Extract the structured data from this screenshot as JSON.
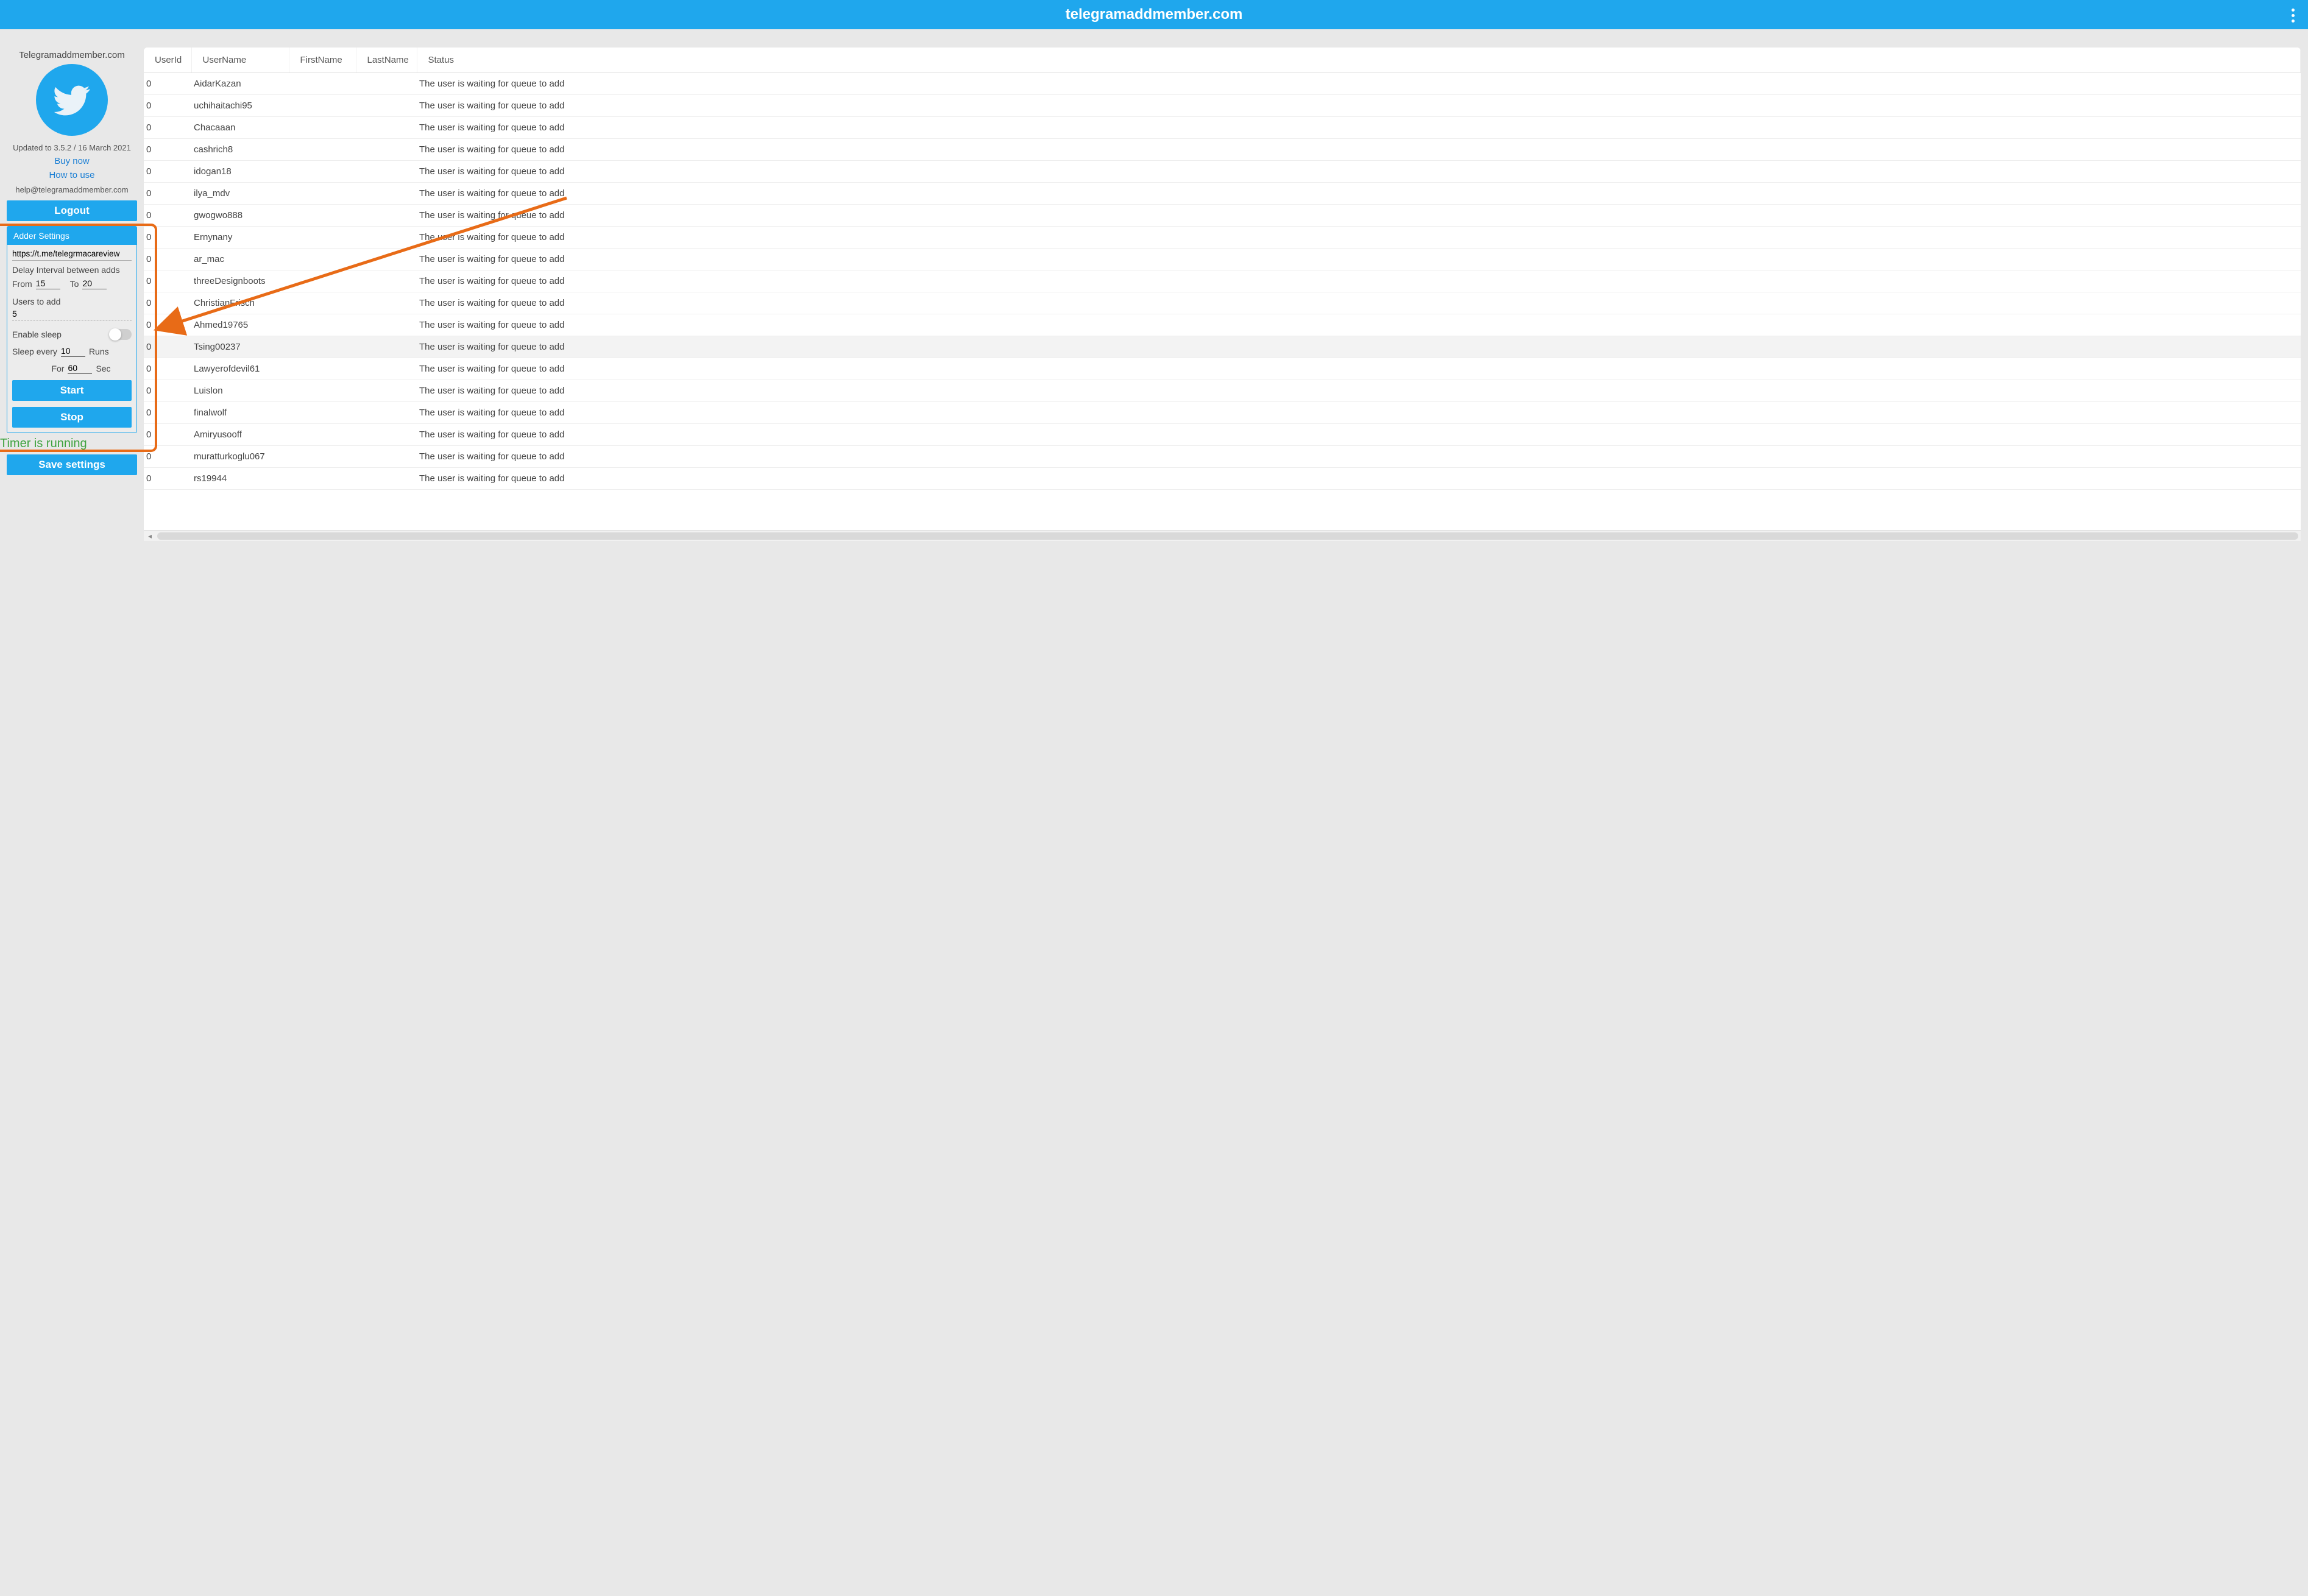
{
  "topbar": {
    "title": "telegramaddmember.com"
  },
  "sidebar": {
    "brand": "Telegramaddmember.com",
    "updated": "Updated to 3.5.2 / 16 March 2021",
    "buy": "Buy now",
    "howto": "How to use",
    "help": "help@telegramaddmember.com",
    "logout": "Logout",
    "save": "Save settings"
  },
  "panel": {
    "title": "Adder Settings",
    "url": "https://t.me/telegrmacareview",
    "delay_label": "Delay Interval between adds",
    "from_label": "From",
    "from_val": "15",
    "to_label": "To",
    "to_val": "20",
    "users_label": "Users to add",
    "users_val": "5",
    "sleep_label": "Enable sleep",
    "sleep_every_a": "Sleep every",
    "sleep_every_val": "10",
    "sleep_every_b": "Runs",
    "for_label": "For",
    "for_val": "60",
    "for_unit": "Sec",
    "start": "Start",
    "stop": "Stop"
  },
  "timer": "Timer is running",
  "table": {
    "headers": {
      "id": "UserId",
      "un": "UserName",
      "fn": "FirstName",
      "ln": "LastName",
      "st": "Status"
    },
    "rows": [
      {
        "id": "0",
        "un": "AidarKazan",
        "fn": "",
        "ln": "",
        "st": "The user is waiting for queue to add",
        "hl": false
      },
      {
        "id": "0",
        "un": "uchihaitachi95",
        "fn": "",
        "ln": "",
        "st": "The user is waiting for queue to add",
        "hl": false
      },
      {
        "id": "0",
        "un": "Chacaaan",
        "fn": "",
        "ln": "",
        "st": "The user is waiting for queue to add",
        "hl": false
      },
      {
        "id": "0",
        "un": "cashrich8",
        "fn": "",
        "ln": "",
        "st": "The user is waiting for queue to add",
        "hl": false
      },
      {
        "id": "0",
        "un": "idogan18",
        "fn": "",
        "ln": "",
        "st": "The user is waiting for queue to add",
        "hl": false
      },
      {
        "id": "0",
        "un": "ilya_mdv",
        "fn": "",
        "ln": "",
        "st": "The user is waiting for queue to add",
        "hl": false
      },
      {
        "id": "0",
        "un": "gwogwo888",
        "fn": "",
        "ln": "",
        "st": "The user is waiting for queue to add",
        "hl": false
      },
      {
        "id": "0",
        "un": "Ernynany",
        "fn": "",
        "ln": "",
        "st": "The user is waiting for queue to add",
        "hl": false
      },
      {
        "id": "0",
        "un": "ar_mac",
        "fn": "",
        "ln": "",
        "st": "The user is waiting for queue to add",
        "hl": false
      },
      {
        "id": "0",
        "un": "threeDesignboots",
        "fn": "",
        "ln": "",
        "st": "The user is waiting for queue to add",
        "hl": false
      },
      {
        "id": "0",
        "un": "ChristianFrisch",
        "fn": "",
        "ln": "",
        "st": "The user is waiting for queue to add",
        "hl": false
      },
      {
        "id": "0",
        "un": "Ahmed19765",
        "fn": "",
        "ln": "",
        "st": "The user is waiting for queue to add",
        "hl": false
      },
      {
        "id": "0",
        "un": "Tsing00237",
        "fn": "",
        "ln": "",
        "st": "The user is waiting for queue to add",
        "hl": true
      },
      {
        "id": "0",
        "un": "Lawyerofdevil61",
        "fn": "",
        "ln": "",
        "st": "The user is waiting for queue to add",
        "hl": false
      },
      {
        "id": "0",
        "un": "Luislon",
        "fn": "",
        "ln": "",
        "st": "The user is waiting for queue to add",
        "hl": false
      },
      {
        "id": "0",
        "un": "finalwolf",
        "fn": "",
        "ln": "",
        "st": "The user is waiting for queue to add",
        "hl": false
      },
      {
        "id": "0",
        "un": "Amiryusooff",
        "fn": "",
        "ln": "",
        "st": "The user is waiting for queue to add",
        "hl": false
      },
      {
        "id": "0",
        "un": "muratturkoglu067",
        "fn": "",
        "ln": "",
        "st": "The user is waiting for queue to add",
        "hl": false
      },
      {
        "id": "0",
        "un": "rs19944",
        "fn": "",
        "ln": "",
        "st": "The user is waiting for queue to add",
        "hl": false
      }
    ]
  }
}
